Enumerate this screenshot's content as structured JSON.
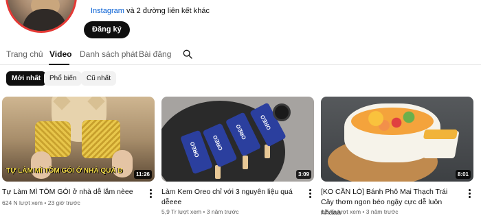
{
  "channel": {
    "links_link": "Instagram",
    "links_rest": "và 2 đường liên kết khác",
    "subscribe_label": "Đăng ký"
  },
  "tabs": [
    {
      "label": "Trang chủ",
      "active": false
    },
    {
      "label": "Video",
      "active": true
    },
    {
      "label": "Danh sách phát",
      "active": false
    },
    {
      "label": "Bài đăng",
      "active": false
    }
  ],
  "search_icon": "search-icon",
  "chips": [
    {
      "label": "Mới nhất",
      "active": true
    },
    {
      "label": "Phổ biến",
      "active": false
    },
    {
      "label": "Cũ nhất",
      "active": false
    }
  ],
  "videos": [
    {
      "title": "Tự Làm MÌ TÔM GÓI ở nhà dễ lắm nèee",
      "duration": "11:26",
      "views": "624 N lượt xem",
      "age": "23 giờ trước",
      "thumb_text": "TỰ LÀM MÌ TÔM GÓI Ở NHÀ QUÁ D"
    },
    {
      "title": "Làm Kem Oreo chỉ với 3 nguyên liệu quá dễeee",
      "duration": "3:09",
      "views": "5,9 Tr lượt xem",
      "age": "3 năm trước",
      "thumb_text": "OREO"
    },
    {
      "title": "[KO CẦN LÒ] Bánh Phô Mai Thạch Trái Cây thơm ngon béo ngậy cực dễ luôn nhaaa",
      "duration": "8:01",
      "views": "1,5 Tr lượt xem",
      "age": "3 năm trước"
    }
  ],
  "separator": "•",
  "colors": {
    "text_primary": "#0f0f0f",
    "text_secondary": "#606060",
    "link": "#065fd4",
    "chip_bg": "#f2f2f2",
    "avatar_ring": "#e53935"
  }
}
